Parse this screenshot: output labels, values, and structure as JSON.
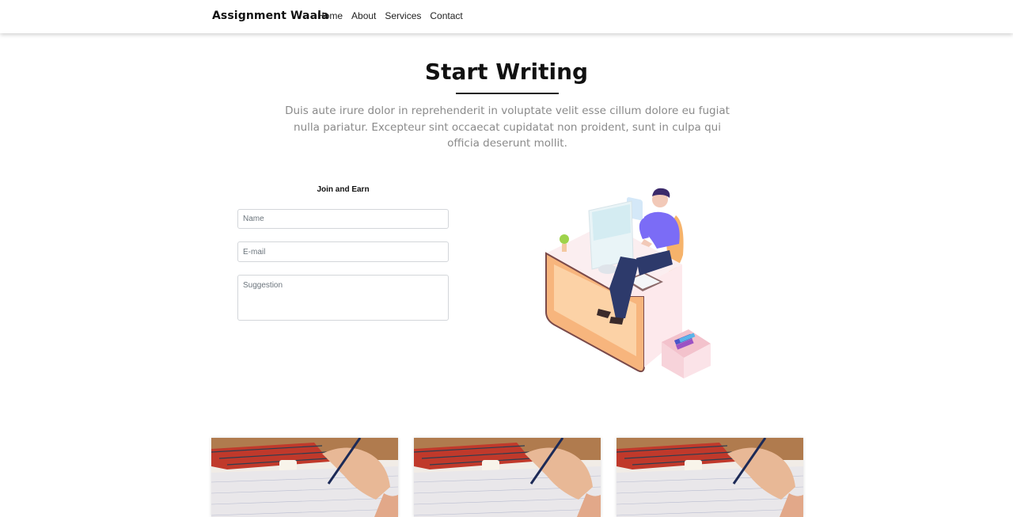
{
  "navbar": {
    "brand": "Assignment Waala",
    "links": [
      "Home",
      "About",
      "Services",
      "Contact"
    ]
  },
  "hero": {
    "title": "Start Writing",
    "lead": "Duis aute irure dolor in reprehenderit in voluptate velit esse cillum dolore eu fugiat nulla pariatur. Excepteur sint occaecat cupidatat non proident, sunt in culpa qui officia deserunt mollit."
  },
  "form": {
    "heading": "Join and Earn",
    "name_placeholder": "Name",
    "email_placeholder": "E-mail",
    "suggestion_placeholder": "Suggestion"
  },
  "illustration": {
    "icon": "person-at-desk-illustration"
  },
  "cards": [
    {
      "image": "hand-writing-on-paper-photo"
    },
    {
      "image": "hand-writing-on-paper-photo"
    },
    {
      "image": "hand-writing-on-paper-photo"
    }
  ],
  "colors": {
    "shirt": "#7b6cf6",
    "desk": "#f7b57d",
    "accent_text": "#8a8a8a"
  }
}
